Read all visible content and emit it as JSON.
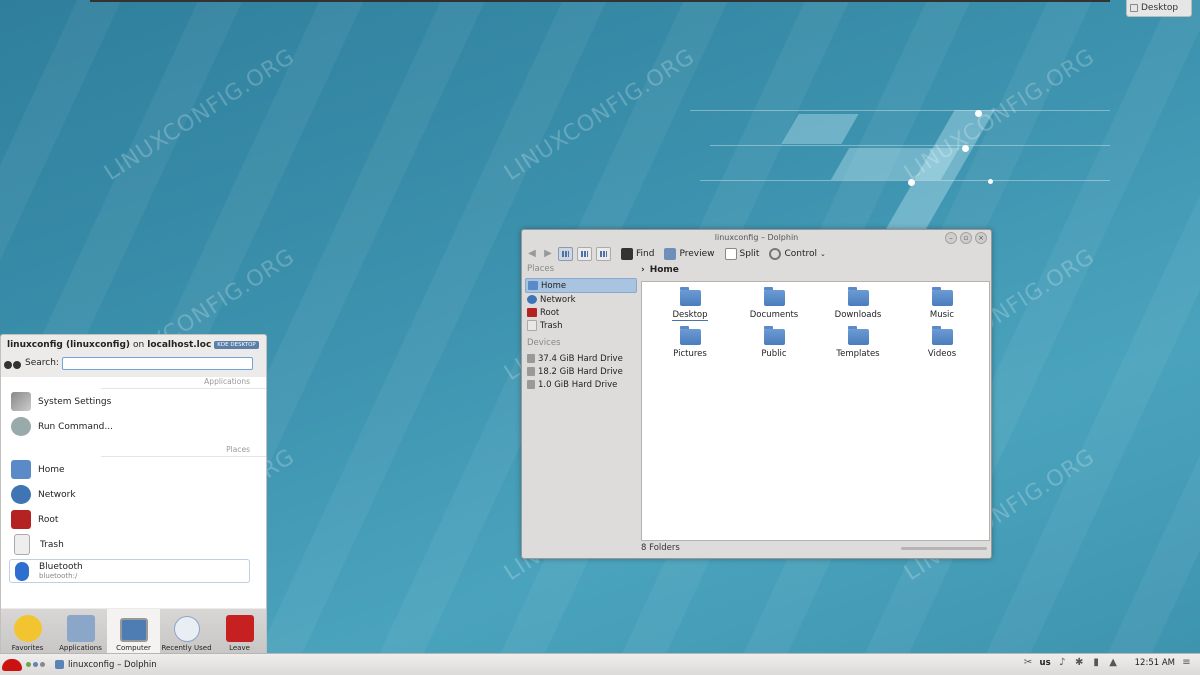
{
  "desktop": {
    "watermark_text": "LINUXCONFIG.ORG",
    "toolbox_label": "Desktop"
  },
  "dolphin": {
    "title": "linuxconfig – Dolphin",
    "toolbar": {
      "find": "Find",
      "preview": "Preview",
      "split": "Split",
      "control": "Control"
    },
    "places_header": "Places",
    "places": [
      "Home",
      "Network",
      "Root",
      "Trash"
    ],
    "devices_header": "Devices",
    "devices": [
      "37.4 GiB Hard Drive",
      "18.2 GiB Hard Drive",
      "1.0 GiB Hard Drive"
    ],
    "breadcrumb": "Home",
    "folders": [
      "Desktop",
      "Documents",
      "Downloads",
      "Music",
      "Pictures",
      "Public",
      "Templates",
      "Videos"
    ],
    "status": "8 Folders"
  },
  "launcher": {
    "user": "linuxconfig (linuxconfig)",
    "on_text": "on",
    "host": "localhost.loc",
    "badge": "KDE DESKTOP",
    "search_label": "Search:",
    "search_value": "",
    "applications_header": "Applications",
    "applications": [
      "System Settings",
      "Run Command..."
    ],
    "places_header": "Places",
    "places": [
      "Home",
      "Network",
      "Root",
      "Trash"
    ],
    "bluetooth": {
      "label": "Bluetooth",
      "sub": "bluetooth:/"
    },
    "tabs": [
      "Favorites",
      "Applications",
      "Computer",
      "Recently Used",
      "Leave"
    ]
  },
  "taskbar": {
    "task_label": "linuxconfig – Dolphin",
    "keyboard_layout": "us",
    "clock": "12:51 AM"
  }
}
